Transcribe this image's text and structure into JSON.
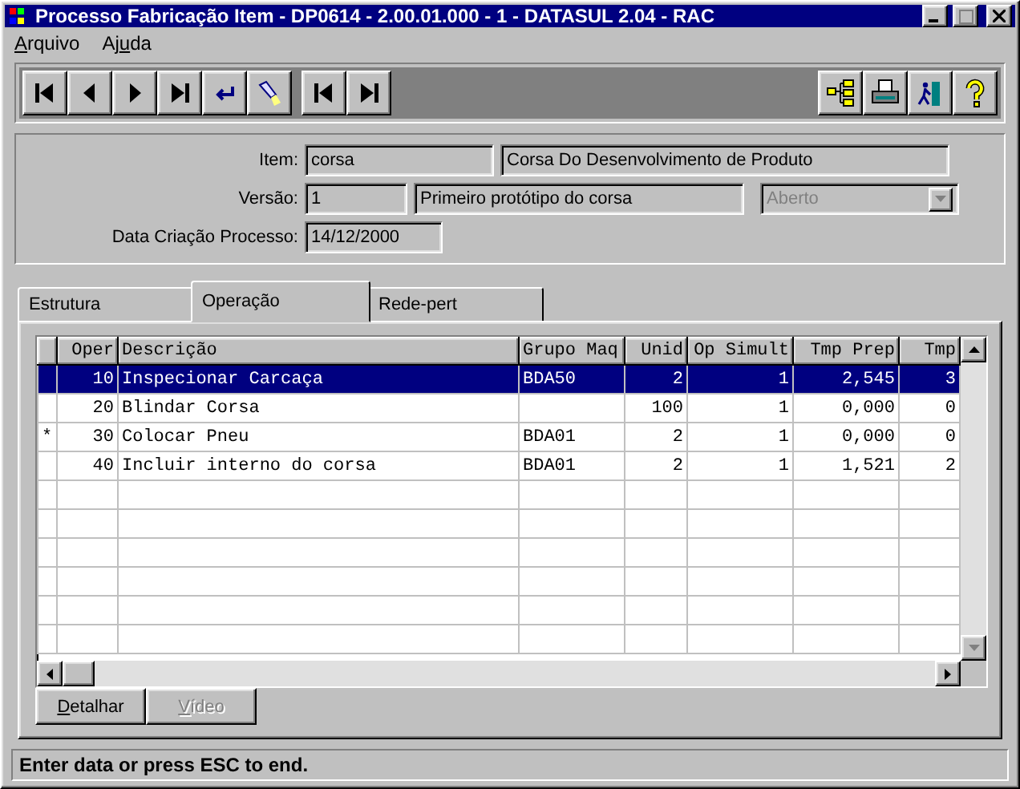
{
  "window": {
    "title": "Processo Fabricação Item - DP0614 - 2.00.01.000 - 1 - DATASUL 2.04 - RAC"
  },
  "menu": [
    {
      "key": "A",
      "post": "rquivo"
    },
    {
      "pre": "Aj",
      "key": "u",
      "post": "da"
    }
  ],
  "toolbar": {
    "left": [
      {
        "kind": "first"
      },
      {
        "kind": "prev"
      },
      {
        "kind": "next"
      },
      {
        "kind": "last"
      },
      {
        "kind": "goto"
      },
      {
        "kind": "search"
      },
      {
        "kind": "sep"
      },
      {
        "kind": "first"
      },
      {
        "kind": "last"
      }
    ],
    "right": [
      {
        "kind": "tree"
      },
      {
        "kind": "print"
      },
      {
        "kind": "exit"
      },
      {
        "kind": "help"
      }
    ]
  },
  "form": {
    "item_label": "Item:",
    "item_code": "corsa",
    "item_description": "Corsa Do Desenvolvimento de Produto",
    "version_label": "Versão:",
    "version": "1",
    "version_description": "Primeiro protótipo do corsa",
    "status": {
      "value": "Aberto",
      "disabled": true
    },
    "date_label": "Data Criação Processo:",
    "date": "14/12/2000"
  },
  "tabs": [
    {
      "label": "Estrutura",
      "selected": false
    },
    {
      "label": "Operação",
      "selected": true
    },
    {
      "label": "Rede-pert",
      "selected": false
    }
  ],
  "table": {
    "columns": [
      {
        "label": "Oper"
      },
      {
        "label": "Descrição"
      },
      {
        "label": "Grupo Maq"
      },
      {
        "label": "Unid"
      },
      {
        "label": "Op Simult"
      },
      {
        "label": "Tmp Prep"
      },
      {
        "label": "Tmp"
      }
    ],
    "rows": [
      {
        "selected": true,
        "cells": [
          "10",
          "Inspecionar Carcaça",
          "BDA50",
          "2",
          "1",
          "2,545",
          "3"
        ]
      },
      {
        "selected": false,
        "cells": [
          "20",
          "Blindar Corsa",
          "",
          "100",
          "1",
          "0,000",
          "0"
        ]
      },
      {
        "selected": false,
        "marker": "*",
        "cells": [
          "30",
          "Colocar Pneu",
          "BDA01",
          "2",
          "1",
          "0,000",
          "0"
        ]
      },
      {
        "selected": false,
        "cells": [
          "40",
          "Incluir interno do corsa",
          "BDA01",
          "2",
          "1",
          "1,521",
          "2"
        ]
      }
    ]
  },
  "buttons": [
    {
      "key": "D",
      "post": "etalhar",
      "disabled": false
    },
    {
      "key": "V",
      "post": "ídeo",
      "disabled": true
    }
  ],
  "status_bar": "Enter data or press ESC to end."
}
